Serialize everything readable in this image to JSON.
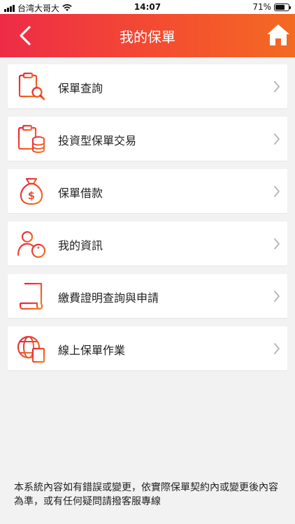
{
  "status": {
    "carrier": "台湾大哥大",
    "time": "14:07",
    "battery": "71%",
    "battery_level": 0.71
  },
  "header": {
    "title": "我的保單"
  },
  "menu": {
    "items": [
      {
        "label": "保單查詢",
        "icon": "policy-search-icon"
      },
      {
        "label": "投資型保單交易",
        "icon": "investment-policy-icon"
      },
      {
        "label": "保單借款",
        "icon": "money-bag-icon"
      },
      {
        "label": "我的資訊",
        "icon": "user-info-icon"
      },
      {
        "label": "繳費證明查詢與申請",
        "icon": "certificate-scroll-icon"
      },
      {
        "label": "線上保單作業",
        "icon": "globe-document-icon"
      }
    ]
  },
  "footer": {
    "note": "本系統內容如有錯誤或變更，依實際保單契約內或變更後內容為準，或有任何疑問請撥客服專線"
  },
  "colors": {
    "accent_start": "#ee2b47",
    "accent_end": "#f36a22",
    "background": "#f2f2f2"
  }
}
